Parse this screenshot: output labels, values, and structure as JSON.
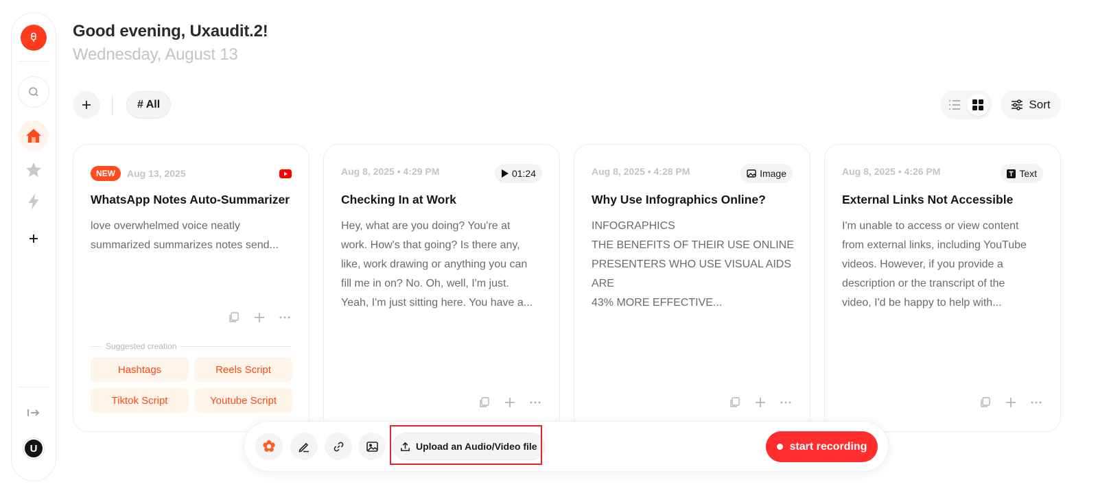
{
  "header": {
    "greeting": "Good evening, Uxaudit.2!",
    "date": "Wednesday, August 13"
  },
  "filters": {
    "add_label": "+",
    "active_tag": "# All"
  },
  "toolbar": {
    "sort_label": "Sort",
    "view_mode": "grid"
  },
  "cards": [
    {
      "badge": "NEW",
      "date": "Aug 13, 2025",
      "type": "youtube-icon",
      "title": "WhatsApp Notes Auto-Summarizer",
      "lines": [
        "love overwhelmed voice neatly",
        "summarized summarizes notes send..."
      ],
      "suggested_label": "Suggested creation",
      "suggestions": [
        "Hashtags",
        "Reels Script",
        "Tiktok Script",
        "Youtube Script"
      ]
    },
    {
      "date": "Aug 8, 2025 • 4:29 PM",
      "type_label": "01:24",
      "title": "Checking In at Work",
      "lines": [
        "Hey, what are you doing? You're at",
        "work. How's that going? Is there any,",
        "like, work drawing or anything you can",
        "fill me in on? No. Oh, well, I'm just.",
        "Yeah, I'm just sitting here. You have a..."
      ]
    },
    {
      "date": "Aug 8, 2025 • 4:28 PM",
      "type_label": "Image",
      "title": "Why Use Infographics Online?",
      "lines": [
        "INFOGRAPHICS",
        "THE BENEFITS OF THEIR USE ONLINE",
        "PRESENTERS WHO USE VISUAL AIDS",
        "ARE",
        "43% MORE EFFECTIVE..."
      ]
    },
    {
      "date": "Aug 8, 2025 • 4:26 PM",
      "type_label": "Text",
      "title": "External Links Not Accessible",
      "lines": [
        "I'm unable to access or view content",
        "from external links, including YouTube",
        "videos. However, if you provide a",
        "description or the transcript of the",
        "video, I'd be happy to help with..."
      ]
    }
  ],
  "bottom_bar": {
    "upload_label": "Upload an Audio/Video file",
    "record_label": "start recording"
  },
  "user": {
    "avatar_initial": "U"
  },
  "colors": {
    "accent": "#ff3b1f",
    "record": "#ff2d2d",
    "chip_bg": "#fff4ea",
    "chip_text": "#ff4a14",
    "highlight": "#e8222a"
  }
}
